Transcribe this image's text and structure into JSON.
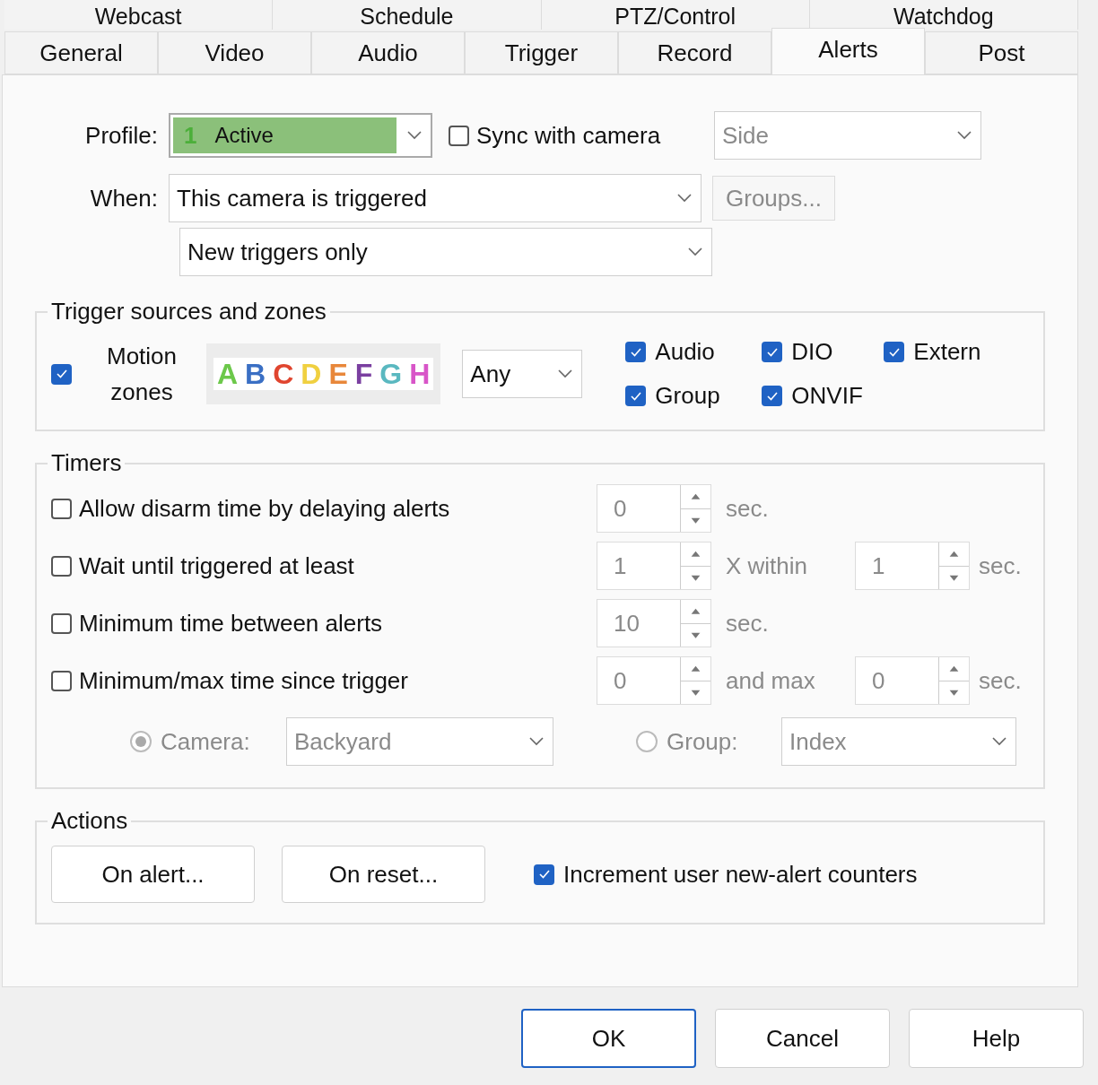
{
  "tabs_row_1": [
    {
      "label": "Webcast",
      "selected": false
    },
    {
      "label": "Schedule",
      "selected": false
    },
    {
      "label": "PTZ/Control",
      "selected": false
    },
    {
      "label": "Watchdog",
      "selected": false
    }
  ],
  "tabs_row_2": [
    {
      "label": "General",
      "selected": false
    },
    {
      "label": "Video",
      "selected": false
    },
    {
      "label": "Audio",
      "selected": false
    },
    {
      "label": "Trigger",
      "selected": false
    },
    {
      "label": "Record",
      "selected": false
    },
    {
      "label": "Alerts",
      "selected": true
    },
    {
      "label": "Post",
      "selected": false
    }
  ],
  "profile": {
    "label": "Profile:",
    "number": "1",
    "value": "Active"
  },
  "sync": {
    "label": "Sync with camera",
    "checked": false
  },
  "side_select": {
    "value": "Side",
    "disabled": true
  },
  "when": {
    "label": "When:",
    "value": "This camera is triggered",
    "second_value": "New triggers only"
  },
  "groups_button": {
    "label": "Groups...",
    "disabled": true
  },
  "trigger_sources": {
    "title": "Trigger sources and zones",
    "motion": {
      "label": "Motion zones",
      "checked": true,
      "mode": "Any",
      "zones": [
        {
          "letter": "A",
          "color": "#6cc84a"
        },
        {
          "letter": "B",
          "color": "#3a6fc4"
        },
        {
          "letter": "C",
          "color": "#e0452f"
        },
        {
          "letter": "D",
          "color": "#f0d040"
        },
        {
          "letter": "E",
          "color": "#e8873a"
        },
        {
          "letter": "F",
          "color": "#7a3fa0"
        },
        {
          "letter": "G",
          "color": "#5ab8c0"
        },
        {
          "letter": "H",
          "color": "#d855c8"
        }
      ]
    },
    "sources": [
      {
        "label": "Audio",
        "checked": true
      },
      {
        "label": "DIO",
        "checked": true
      },
      {
        "label": "Extern",
        "checked": true
      },
      {
        "label": "Group",
        "checked": true
      },
      {
        "label": "ONVIF",
        "checked": true
      }
    ]
  },
  "timers": {
    "title": "Timers",
    "rows": [
      {
        "label": "Allow disarm time by delaying alerts",
        "checked": false,
        "value": "0",
        "suffix": "sec."
      },
      {
        "label": "Wait until triggered at least",
        "checked": false,
        "value": "1",
        "suffix": "X within",
        "second_value": "1",
        "second_suffix": "sec."
      },
      {
        "label": "Minimum time between alerts",
        "checked": false,
        "value": "10",
        "suffix": "sec."
      },
      {
        "label": "Minimum/max time since trigger",
        "checked": false,
        "value": "0",
        "suffix": "and max",
        "second_value": "0",
        "second_suffix": "sec."
      }
    ],
    "targets": [
      {
        "label": "Camera:",
        "selected": true,
        "value": "Backyard"
      },
      {
        "label": "Group:",
        "selected": false,
        "value": "Index"
      }
    ]
  },
  "actions": {
    "title": "Actions",
    "buttons": [
      "On alert...",
      "On reset..."
    ],
    "increment": {
      "label": "Increment user new-alert counters",
      "checked": true
    }
  },
  "footer_buttons": [
    {
      "label": "OK",
      "default": true
    },
    {
      "label": "Cancel",
      "default": false
    },
    {
      "label": "Help",
      "default": false
    }
  ]
}
